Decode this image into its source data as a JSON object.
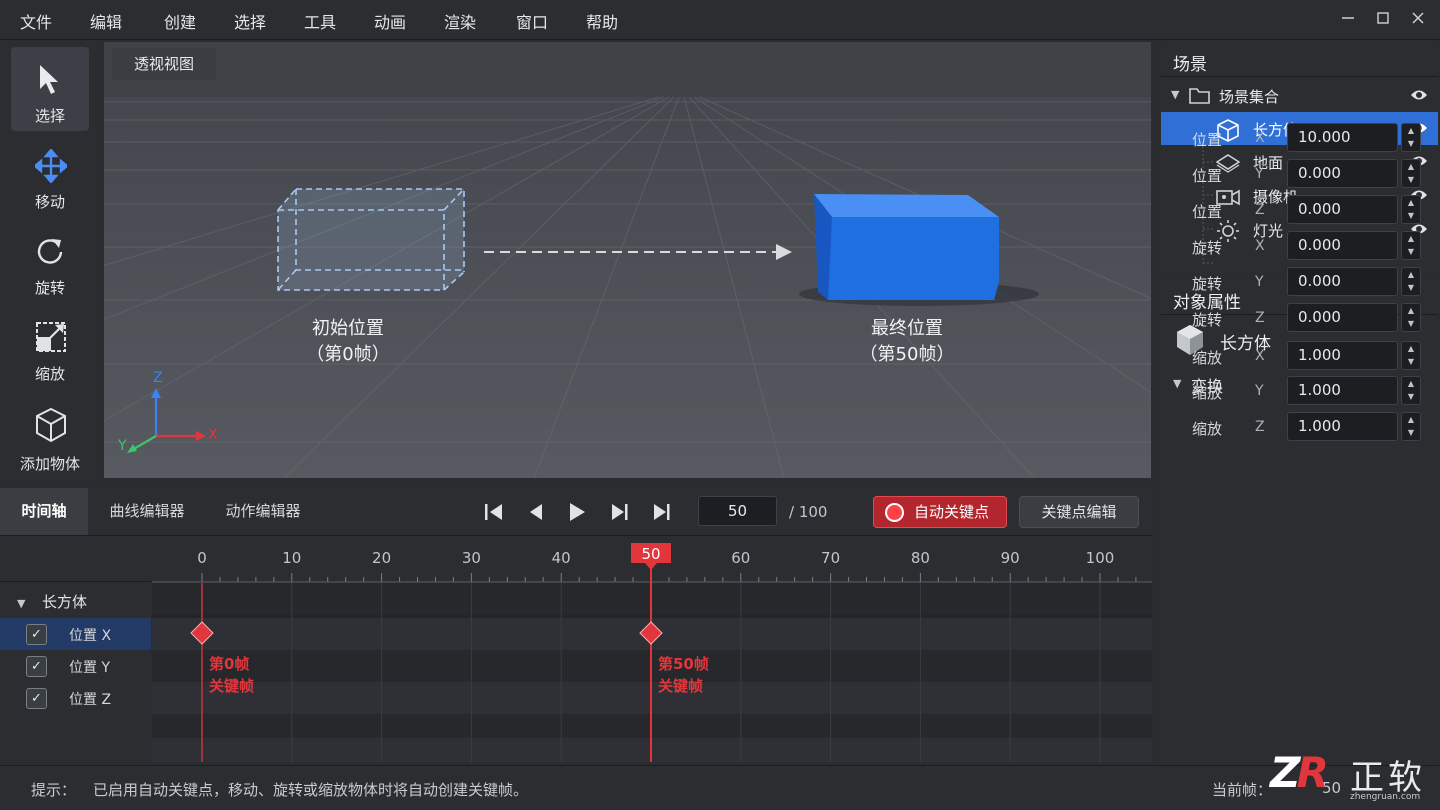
{
  "menubar": {
    "items": [
      "文件",
      "编辑",
      "创建",
      "选择",
      "工具",
      "动画",
      "渲染",
      "窗口",
      "帮助"
    ],
    "window_controls": [
      "minimize-icon",
      "maximize-icon",
      "close-icon"
    ]
  },
  "toolbar": {
    "tools": [
      {
        "label": "选择",
        "icon": "cursor-icon",
        "active": true
      },
      {
        "label": "移动",
        "icon": "move-icon",
        "active": false
      },
      {
        "label": "旋转",
        "icon": "rotate-icon",
        "active": false
      },
      {
        "label": "缩放",
        "icon": "scale-icon",
        "active": false
      },
      {
        "label": "添加物体",
        "icon": "cube-icon",
        "active": false
      }
    ]
  },
  "viewport": {
    "tab": "透视视图",
    "start_label": "初始位置",
    "start_sub": "（第0帧）",
    "end_label": "最终位置",
    "end_sub": "（第50帧）",
    "axes": {
      "x": "X",
      "y": "Y",
      "z": "Z"
    },
    "colors": {
      "cube": "#1f6fe0",
      "ghost": "#a9c8f5"
    }
  },
  "scene": {
    "title": "场景",
    "root": "场景集合",
    "items": [
      {
        "label": "长方体",
        "icon": "cube-icon",
        "selected": true
      },
      {
        "label": "地面",
        "icon": "plane-icon",
        "selected": false
      },
      {
        "label": "摄像机",
        "icon": "camera-icon",
        "selected": false
      },
      {
        "label": "灯光",
        "icon": "light-icon",
        "selected": false
      }
    ]
  },
  "properties": {
    "title": "对象属性",
    "object_name": "长方体",
    "section": "变换",
    "rows": [
      {
        "label": "位置",
        "axis": "X",
        "value": "10.000"
      },
      {
        "label": "位置",
        "axis": "Y",
        "value": "0.000"
      },
      {
        "label": "位置",
        "axis": "Z",
        "value": "0.000"
      },
      {
        "label": "旋转",
        "axis": "X",
        "value": "0.000"
      },
      {
        "label": "旋转",
        "axis": "Y",
        "value": "0.000"
      },
      {
        "label": "旋转",
        "axis": "Z",
        "value": "0.000"
      },
      {
        "label": "缩放",
        "axis": "X",
        "value": "1.000"
      },
      {
        "label": "缩放",
        "axis": "Y",
        "value": "1.000"
      },
      {
        "label": "缩放",
        "axis": "Z",
        "value": "1.000"
      }
    ]
  },
  "timeline": {
    "tabs": [
      "时间轴",
      "曲线编辑器",
      "动作编辑器"
    ],
    "current_frame": "50",
    "total": "/ 100",
    "auto_key_label": "自动关键点",
    "key_edit_label": "关键点编辑",
    "ruler": [
      "0",
      "10",
      "20",
      "30",
      "40",
      "50",
      "60",
      "70",
      "80",
      "90",
      "100"
    ],
    "playhead": "50",
    "object": "长方体",
    "tracks": [
      {
        "label": "位置 X",
        "checked": true,
        "selected": true
      },
      {
        "label": "位置 Y",
        "checked": true,
        "selected": false
      },
      {
        "label": "位置 Z",
        "checked": true,
        "selected": false
      }
    ],
    "keyframes": [
      {
        "frame": 0,
        "line1": "第0帧",
        "line2": "关键帧"
      },
      {
        "frame": 50,
        "line1": "第50帧",
        "line2": "关键帧"
      }
    ],
    "accent": "#e0363c"
  },
  "status": {
    "hint_label": "提示：",
    "hint_text": "已启用自动关键点，移动、旋转或缩放物体时将自动创建关键帧。",
    "current_label": "当前帧：",
    "current_value": "50"
  },
  "watermark": {
    "text": "正软",
    "sub": "zhengruan.com"
  }
}
